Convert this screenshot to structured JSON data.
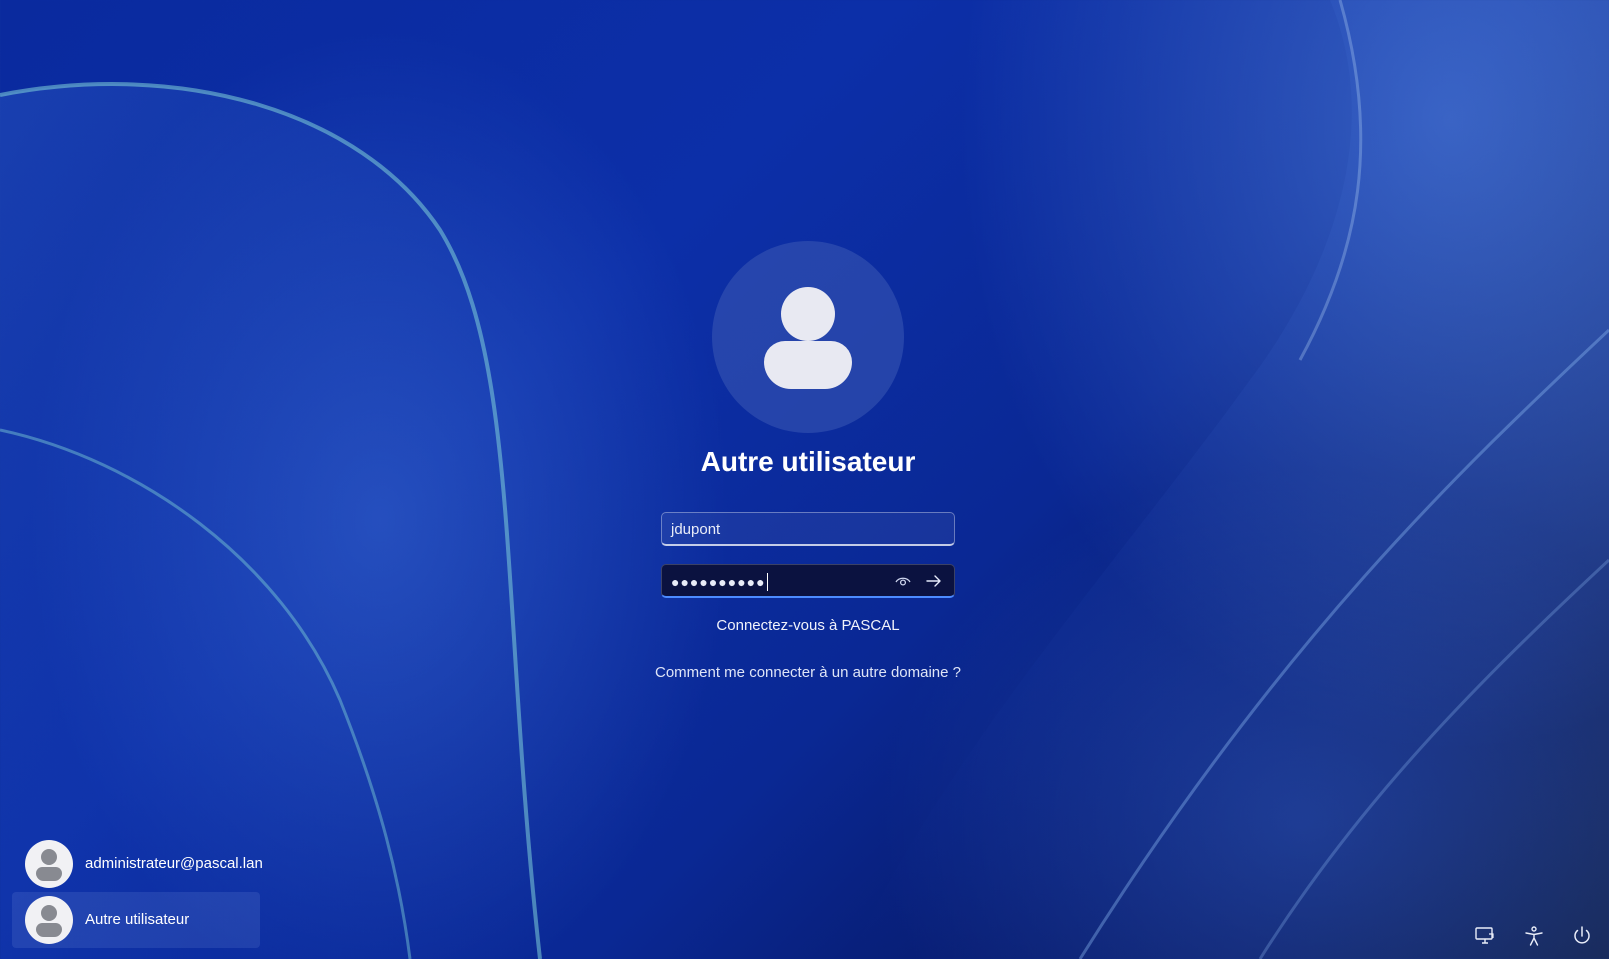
{
  "login": {
    "title": "Autre utilisateur",
    "username_value": "jdupont",
    "password_mask": "●●●●●●●●●●",
    "domain_text": "Connectez-vous à PASCAL",
    "other_domain_link": "Comment me connecter à un autre domaine ?"
  },
  "users": [
    {
      "name": "administrateur@pascal.lan",
      "selected": false
    },
    {
      "name": "Autre utilisateur",
      "selected": true
    }
  ],
  "system_icons": [
    "network-icon",
    "accessibility-icon",
    "power-icon"
  ],
  "colors": {
    "background_primary": "#0c2fa8",
    "background_dark": "#030a2a",
    "focus_accent": "#4c8bff"
  }
}
